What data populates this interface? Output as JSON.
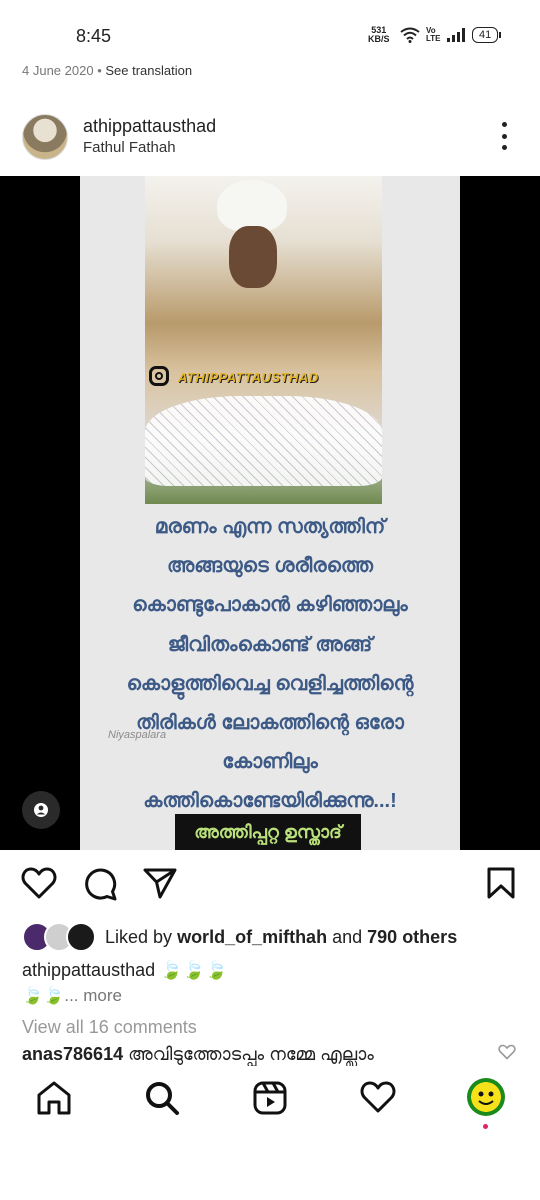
{
  "status_bar": {
    "time": "8:45",
    "net_speed_value": "531",
    "net_speed_unit": "KB/S",
    "volte": "Vo LTE",
    "battery": "41"
  },
  "post": {
    "date": "4 June 2020",
    "see_translation": "See translation",
    "username": "athippattausthad",
    "subtitle": "Fathul Fathah",
    "image": {
      "watermark": "ATHIPPATTAUSTHAD",
      "poem_lines": [
        "മരണം എന്ന സത്യത്തിന്",
        "അങ്ങയുടെ ശരീരത്തെ",
        "കൊണ്ടുപോകാൻ കഴിഞ്ഞാലും",
        "ജീവിതംകൊണ്ട് അങ്ങ്",
        "കൊളുത്തിവെച്ച വെളിച്ചത്തിന്റെ",
        "തിരികൾ ലോകത്തിന്റെ ഒരോ",
        "കോണിലും",
        "കത്തികൊണ്ടേയിരിക്കുന്നു...!"
      ],
      "signature": "Niyaspalara",
      "author": "അത്തിപ്പറ്റ ഉസ്താദ്"
    },
    "likes": {
      "prefix": "Liked by",
      "user": "world_of_mifthah",
      "and": "and",
      "others": "790 others"
    },
    "caption": {
      "username": "athippattausthad",
      "emoji_line1": "🍃🍃🍃",
      "emoji_line2": "🍃🍃",
      "more": "... more"
    },
    "view_comments": "View all 16 comments",
    "comment": {
      "username": "anas786614",
      "text": "അവിടുത്തോടപ്പം നമ്മേ എല്ലാം"
    }
  },
  "colors": {
    "poem_text": "#3d5a87",
    "author_text": "#b9e07a",
    "watermark": "#e4b52a"
  },
  "icons": [
    "heart-icon",
    "comment-icon",
    "share-icon",
    "bookmark-icon",
    "home-icon",
    "search-icon",
    "reels-icon",
    "activity-icon",
    "user-tag-icon",
    "kebab-icon"
  ]
}
